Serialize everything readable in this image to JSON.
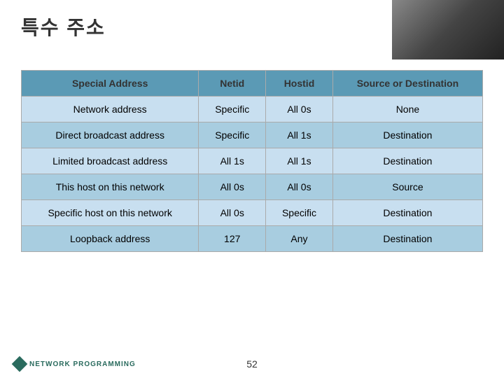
{
  "title": "특수 주소",
  "table": {
    "headers": [
      "Special Address",
      "Netid",
      "Hostid",
      "Source or Destination"
    ],
    "rows": [
      [
        "Network address",
        "Specific",
        "All  0s",
        "None"
      ],
      [
        "Direct broadcast address",
        "Specific",
        "All  1s",
        "Destination"
      ],
      [
        "Limited broadcast address",
        "All  1s",
        "All  1s",
        "Destination"
      ],
      [
        "This host on this network",
        "All  0s",
        "All  0s",
        "Source"
      ],
      [
        "Specific host on this network",
        "All  0s",
        "Specific",
        "Destination"
      ],
      [
        "Loopback address",
        "127",
        "Any",
        "Destination"
      ]
    ]
  },
  "footer": {
    "brand": "NETWORK PROGRAMMING",
    "page": "52"
  }
}
